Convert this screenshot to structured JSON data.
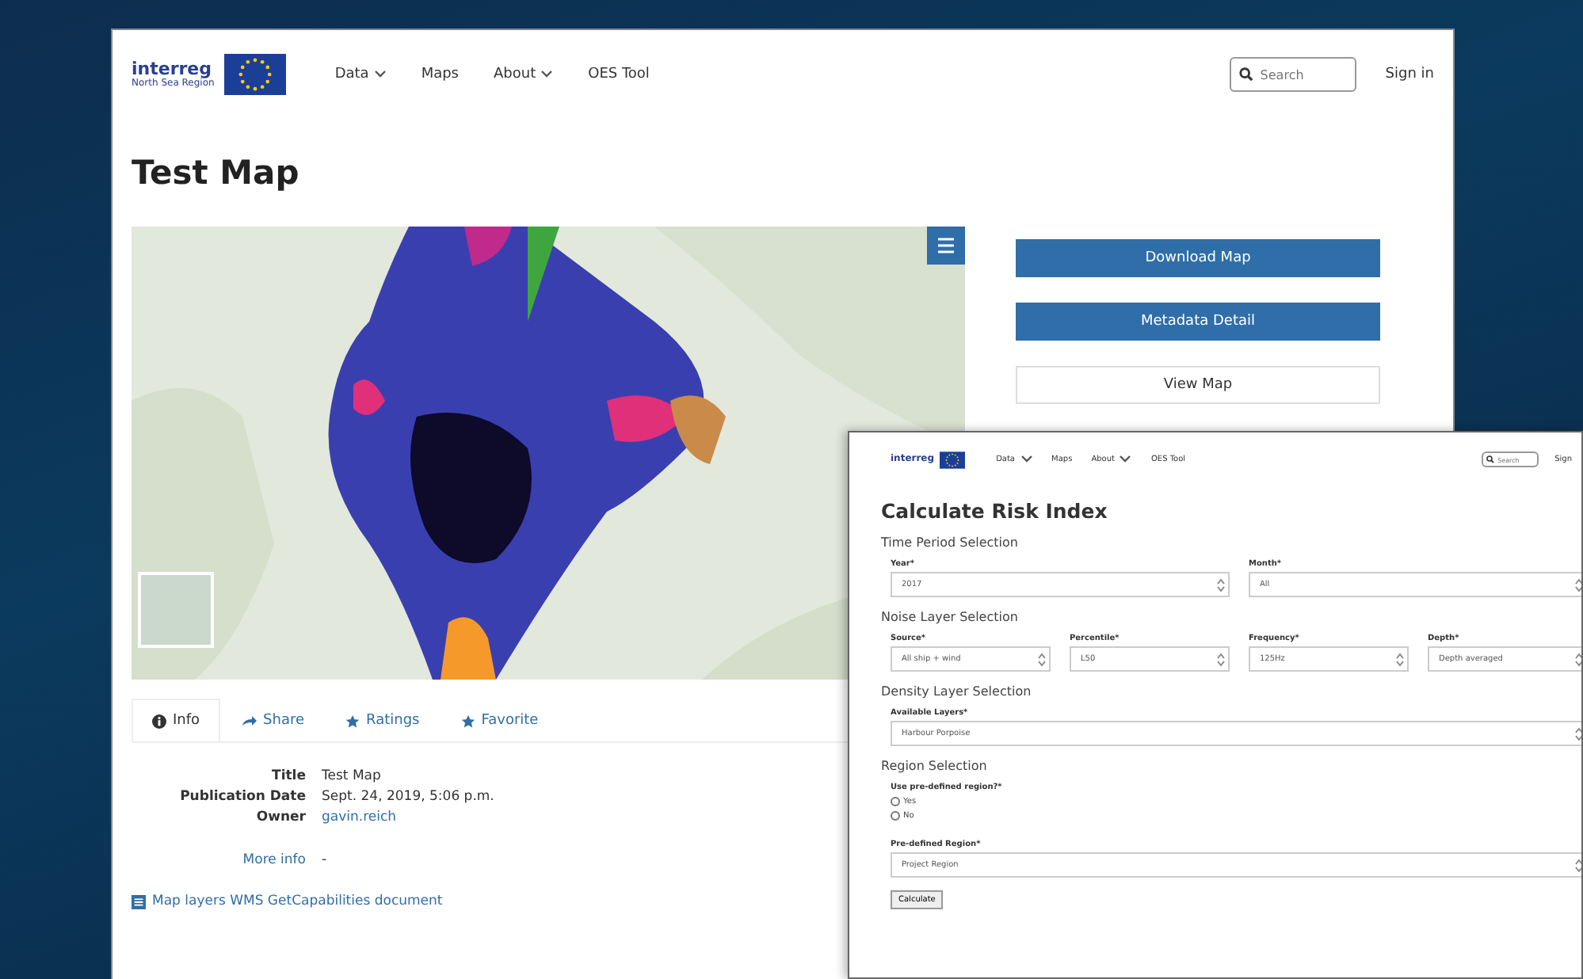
{
  "map_page": {
    "logo": {
      "name": "interreg",
      "subtitle": "North Sea Region"
    },
    "nav": [
      {
        "label": "Data",
        "dropdown": true
      },
      {
        "label": "Maps",
        "dropdown": false
      },
      {
        "label": "About",
        "dropdown": true
      },
      {
        "label": "OES Tool",
        "dropdown": false
      }
    ],
    "search": {
      "placeholder": "Search"
    },
    "sign_in": "Sign in",
    "title": "Test Map",
    "actions": [
      {
        "label": "Download Map",
        "kind": "primary"
      },
      {
        "label": "Metadata Detail",
        "kind": "primary"
      },
      {
        "label": "View Map",
        "kind": "outline"
      }
    ],
    "tabs": [
      {
        "label": "Info",
        "selected": true
      },
      {
        "label": "Share",
        "selected": false
      },
      {
        "label": "Ratings",
        "selected": false
      },
      {
        "label": "Favorite",
        "selected": false
      }
    ],
    "info": [
      {
        "label": "Title",
        "value": "Test Map",
        "link": false
      },
      {
        "label": "Publication Date",
        "value": "Sept. 24, 2019, 5:06 p.m.",
        "link": false
      },
      {
        "label": "Owner",
        "value": "gavin.reich",
        "link": true
      }
    ],
    "more_info": {
      "label": "More info",
      "value": "-"
    },
    "wms_link": "Map layers WMS GetCapabilities document"
  },
  "risk_page": {
    "logo": {
      "name": "interreg"
    },
    "nav": [
      {
        "label": "Data",
        "dropdown": true
      },
      {
        "label": "Maps",
        "dropdown": false
      },
      {
        "label": "About",
        "dropdown": true
      },
      {
        "label": "OES Tool",
        "dropdown": false
      }
    ],
    "search": {
      "placeholder": "Search"
    },
    "sign_in": "Sign",
    "title": "Calculate Risk Index",
    "sections": [
      {
        "heading": "Time Period Selection",
        "fields": [
          {
            "kind": "select",
            "label": "Year*",
            "value": "2017"
          },
          {
            "kind": "select",
            "label": "Month*",
            "value": "All"
          }
        ]
      },
      {
        "heading": "Noise Layer Selection",
        "fields": [
          {
            "kind": "select",
            "label": "Source*",
            "value": "All ship + wind"
          },
          {
            "kind": "select",
            "label": "Percentile*",
            "value": "L50"
          },
          {
            "kind": "select",
            "label": "Frequency*",
            "value": "125Hz"
          },
          {
            "kind": "select",
            "label": "Depth*",
            "value": "Depth averaged"
          }
        ]
      },
      {
        "heading": "Density Layer Selection",
        "fields": [
          {
            "kind": "select",
            "label": "Available Layers*",
            "value": "Harbour Porpoise"
          }
        ]
      },
      {
        "heading": "Region Selection",
        "fields": [
          {
            "kind": "radio",
            "label": "Use pre-defined region?*",
            "options": [
              {
                "label": "Yes",
                "selected": false
              },
              {
                "label": "No",
                "selected": false
              }
            ]
          },
          {
            "kind": "select",
            "label": "Pre-defined Region*",
            "value": "Project Region"
          }
        ]
      }
    ],
    "submit": "Calculate"
  }
}
